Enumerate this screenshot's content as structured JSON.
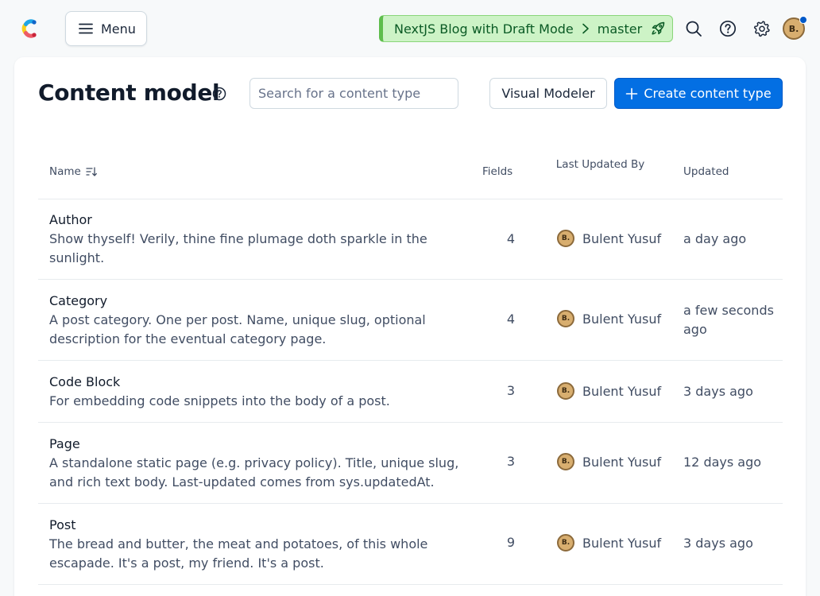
{
  "header": {
    "menu_label": "Menu",
    "space_name": "NextJS Blog with Draft Mode",
    "environment": "master",
    "user_initials": "B."
  },
  "page": {
    "title": "Content model",
    "search_placeholder": "Search for a content type",
    "visual_modeler_label": "Visual Modeler",
    "create_label": "Create content type"
  },
  "table": {
    "columns": {
      "name": "Name",
      "fields": "Fields",
      "last_updated_by": "Last Updated By",
      "updated": "Updated"
    },
    "rows": [
      {
        "name": "Author",
        "description": "Show thyself! Verily, thine fine plumage doth sparkle in the sunlight.",
        "fields": "4",
        "updated_by": "Bulent Yusuf",
        "initials": "B.",
        "updated": "a day ago"
      },
      {
        "name": "Category",
        "description": "A post category. One per post. Name, unique slug, optional description for the eventual category page.",
        "fields": "4",
        "updated_by": "Bulent Yusuf",
        "initials": "B.",
        "updated": "a few seconds ago"
      },
      {
        "name": "Code Block",
        "description": "For embedding code snippets into the body of a post.",
        "fields": "3",
        "updated_by": "Bulent Yusuf",
        "initials": "B.",
        "updated": "3 days ago"
      },
      {
        "name": "Page",
        "description": "A standalone static page (e.g. privacy policy). Title, unique slug, and rich text body. Last-updated comes from sys.updatedAt.",
        "fields": "3",
        "updated_by": "Bulent Yusuf",
        "initials": "B.",
        "updated": "12 days ago"
      },
      {
        "name": "Post",
        "description": "The bread and butter, the meat and potatoes, of this whole escapade. It's a post, my friend. It's a post.",
        "fields": "9",
        "updated_by": "Bulent Yusuf",
        "initials": "B.",
        "updated": "3 days ago"
      }
    ]
  },
  "colors": {
    "primary": "#036fe3",
    "environment_bg": "#cdf3c6",
    "environment_text": "#0a5a24",
    "notification_dot": "#0059c8"
  },
  "icons": [
    "contentful-logo-icon",
    "menu-icon",
    "chevron-right-icon",
    "rocket-icon",
    "search-icon",
    "help-icon",
    "gear-icon",
    "sort-icon",
    "plus-icon"
  ]
}
